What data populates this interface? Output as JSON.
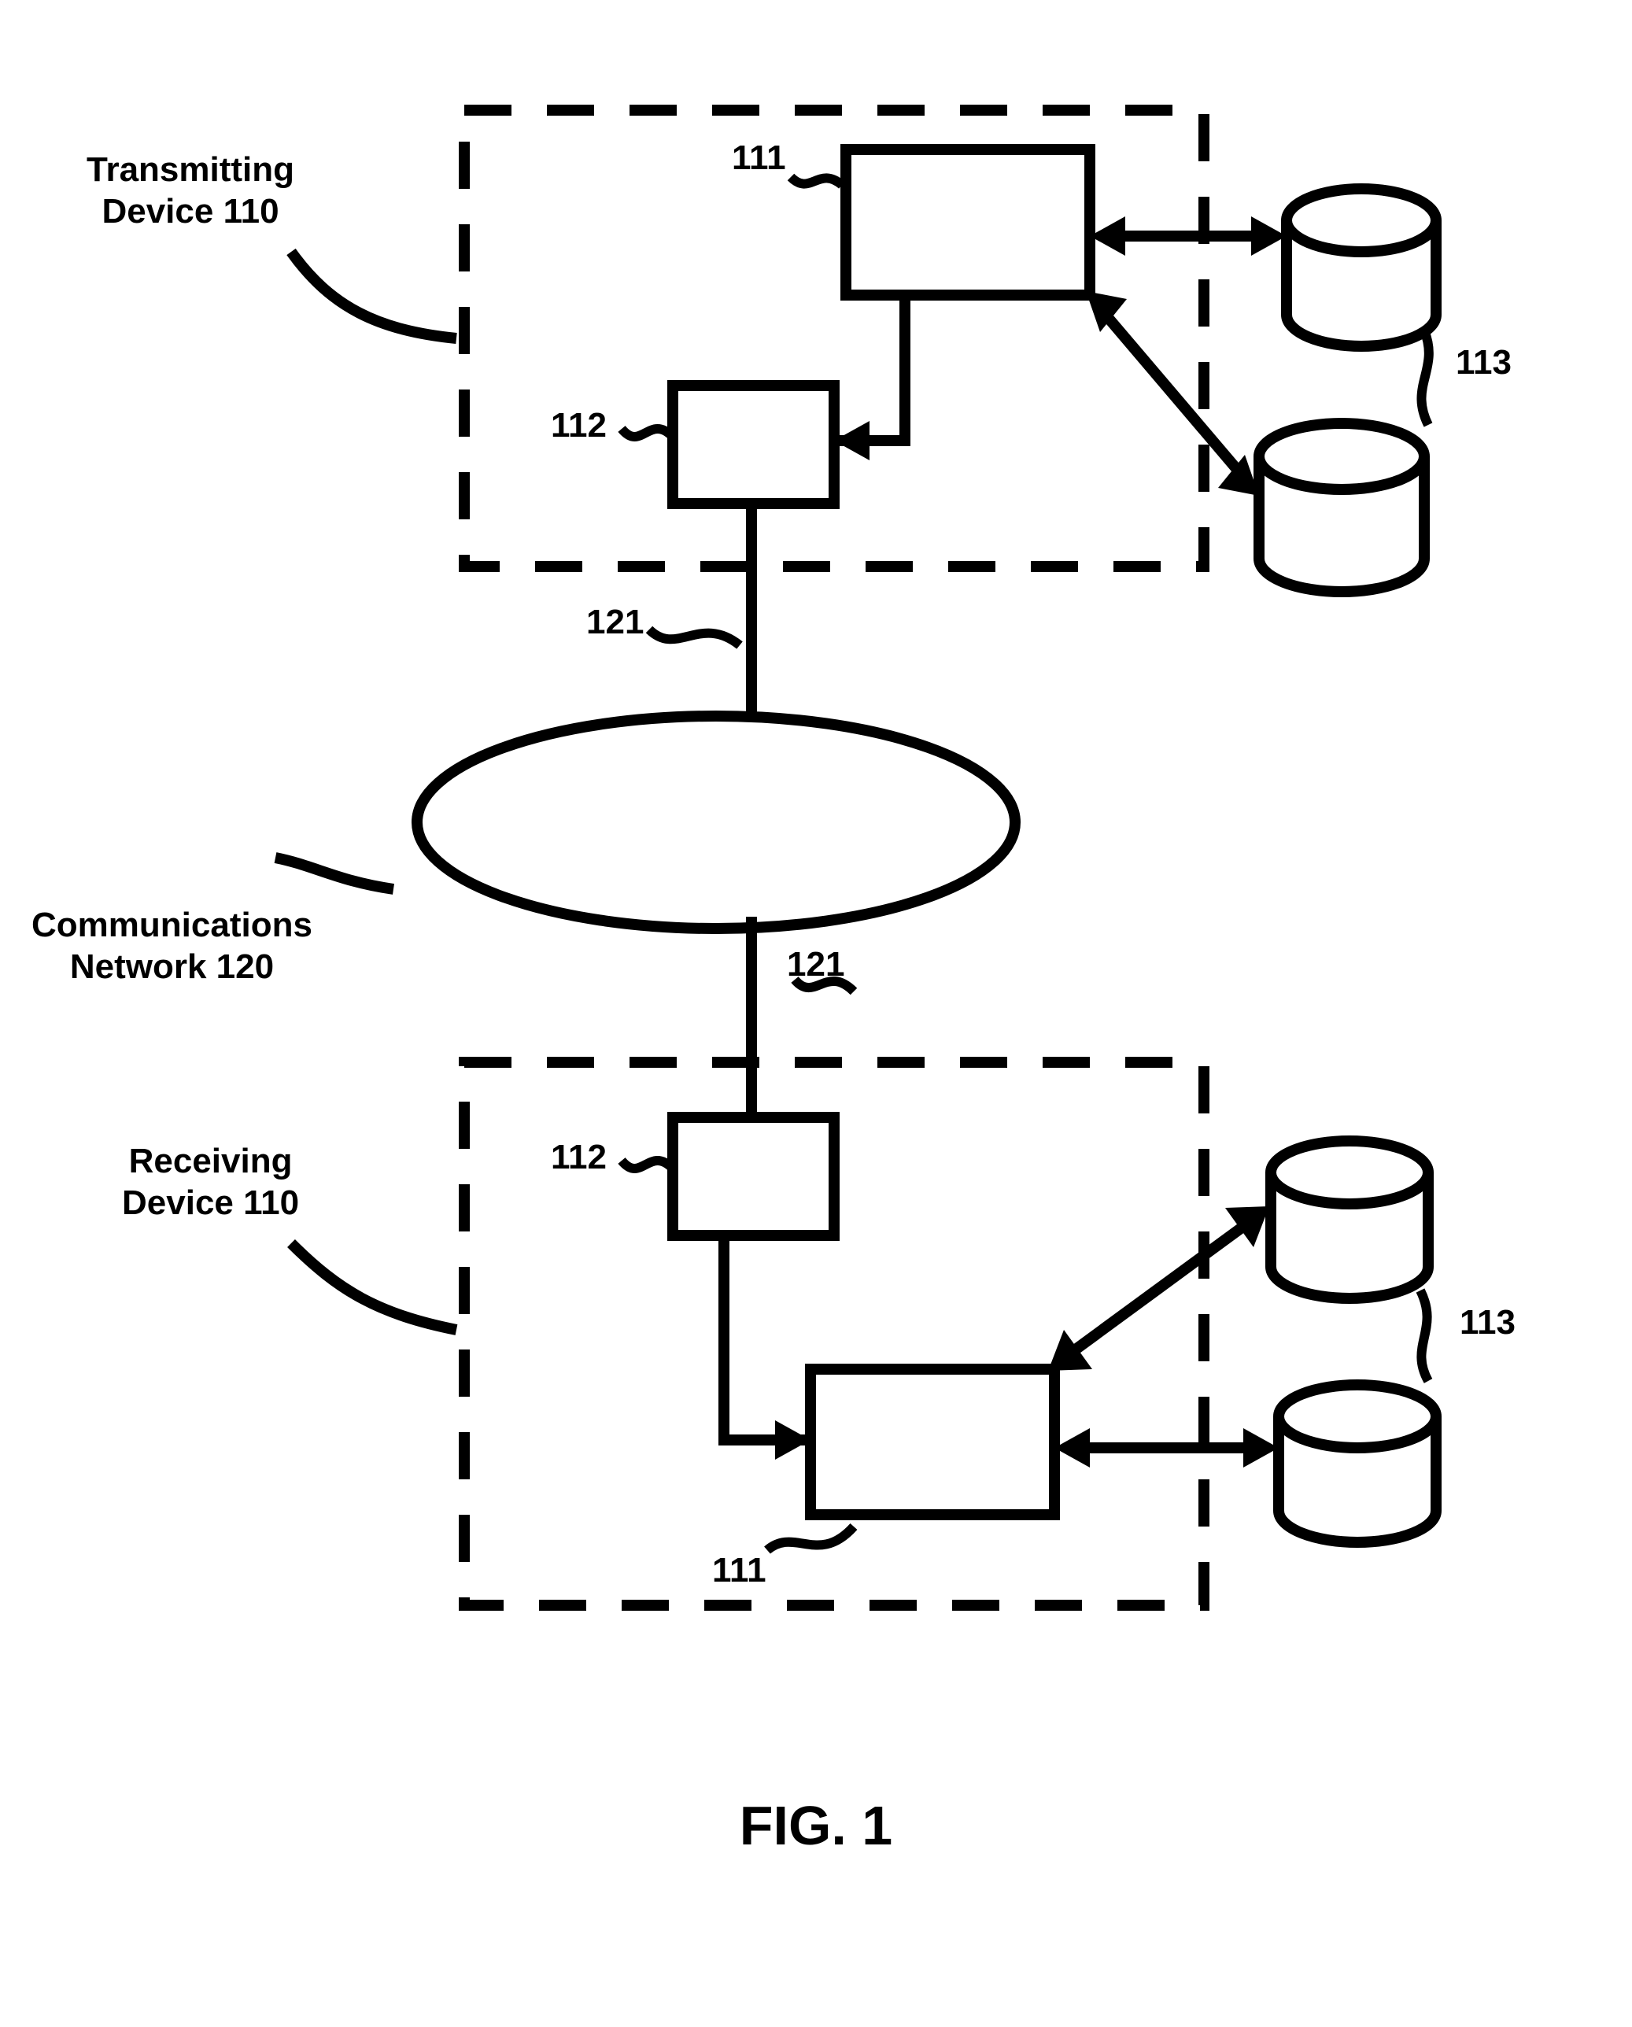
{
  "figure": {
    "title": "FIG. 1"
  },
  "labels": {
    "transmitting_device": "Transmitting\nDevice 110",
    "receiving_device": "Receiving\nDevice 110",
    "comm_network": "Communications\nNetwork 120",
    "ref111_top": "111",
    "ref112_top": "112",
    "ref113_top": "113",
    "ref121_top": "121",
    "ref121_bottom": "121",
    "ref112_bottom": "112",
    "ref113_bottom": "113",
    "ref111_bottom": "111"
  }
}
